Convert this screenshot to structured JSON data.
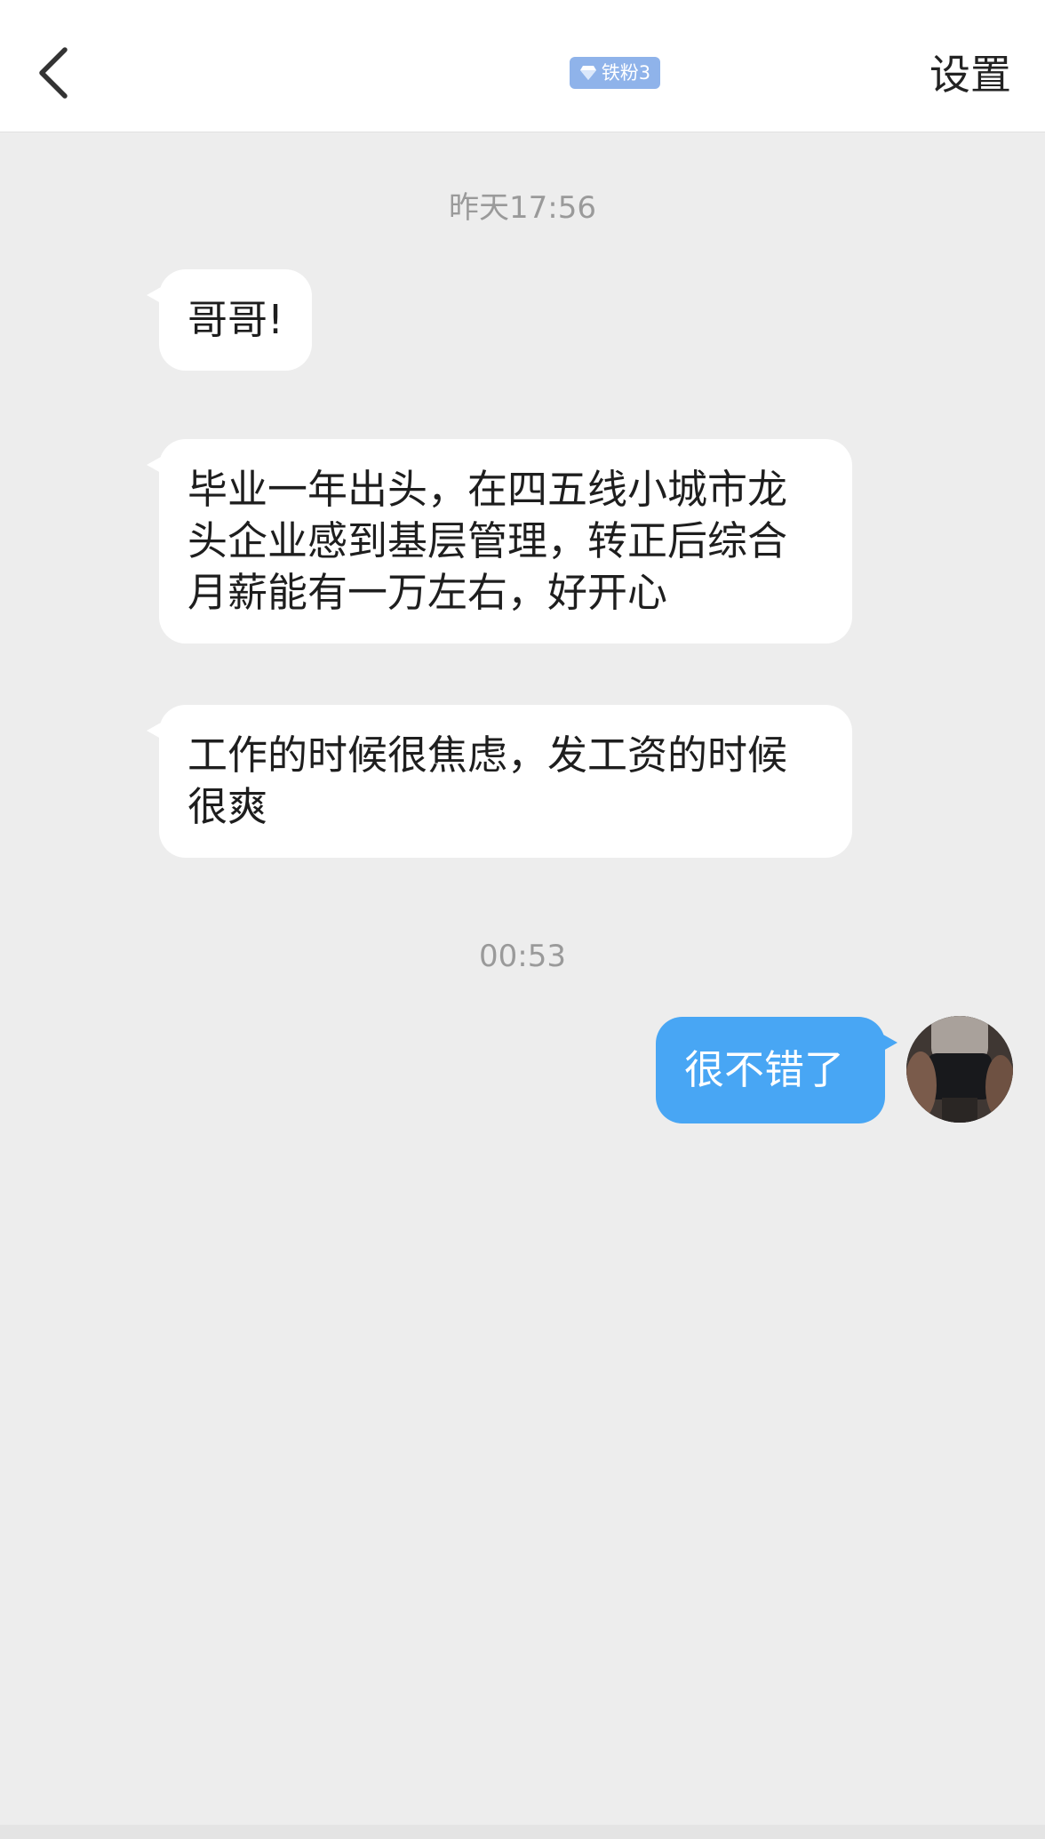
{
  "header": {
    "badge_label": "铁粉3",
    "settings_label": "设置"
  },
  "messages": [
    {
      "type": "time",
      "text": "昨天17:56"
    },
    {
      "type": "incoming",
      "text": "哥哥!"
    },
    {
      "type": "incoming",
      "text": "毕业一年出头，在四五线小城市龙头企业感到基层管理，转正后综合月薪能有一万左右，好开心"
    },
    {
      "type": "incoming",
      "text": "工作的时候很焦虑，发工资的时候很爽"
    },
    {
      "type": "time",
      "text": "00:53"
    },
    {
      "type": "outgoing",
      "text": "很不错了"
    }
  ],
  "colors": {
    "background": "#ededed",
    "incoming_bubble": "#ffffff",
    "outgoing_bubble": "#48a6f4",
    "badge": "#8fb3ea"
  }
}
